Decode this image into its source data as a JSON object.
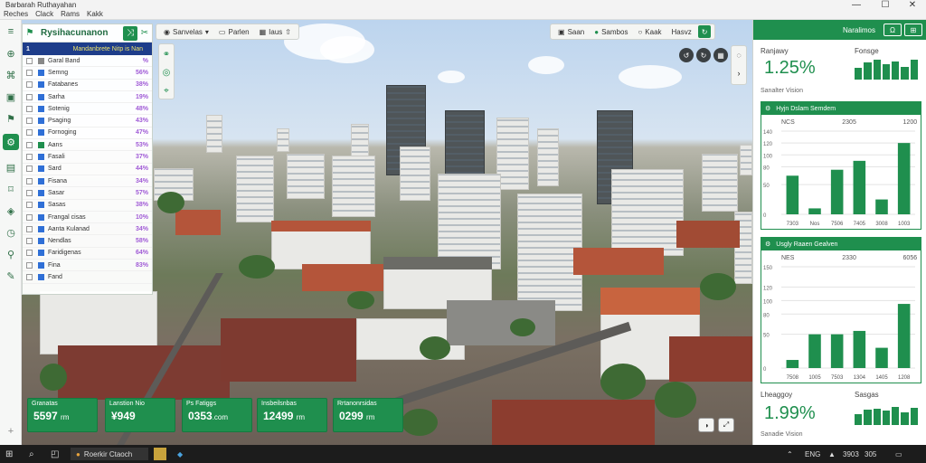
{
  "window": {
    "app_title": "Barbarah Ruthayahan",
    "menu": [
      "Reches",
      "Clack",
      "Rams",
      "Kakk"
    ],
    "minimize": "—",
    "maximize": "☐",
    "close": "✕"
  },
  "rail": {
    "items": [
      {
        "name": "menu-icon",
        "glyph": "≡"
      },
      {
        "name": "globe-icon",
        "glyph": "⊕"
      },
      {
        "name": "chart-icon",
        "glyph": "⌘"
      },
      {
        "name": "building-icon",
        "glyph": "▣"
      },
      {
        "name": "flag-icon",
        "glyph": "⚑"
      },
      {
        "name": "gear-icon",
        "glyph": "⚙"
      },
      {
        "name": "list-icon",
        "glyph": "▤"
      },
      {
        "name": "bookmark-icon",
        "glyph": "⌑"
      },
      {
        "name": "layers-icon",
        "glyph": "◈"
      },
      {
        "name": "clock-icon",
        "glyph": "◷"
      },
      {
        "name": "pin-icon",
        "glyph": "⚲"
      },
      {
        "name": "edit-icon",
        "glyph": "✎"
      }
    ],
    "bottom": "+"
  },
  "layers_panel": {
    "title": "Rysihacunanon",
    "selected": {
      "num": "1",
      "text": "Mandanbrete Nitp is Nan"
    },
    "rows": [
      {
        "name": "Garal Band",
        "pct": "%",
        "color": "#888888"
      },
      {
        "name": "Semng",
        "pct": "56%",
        "color": "#2f6fd6"
      },
      {
        "name": "Fatabanes",
        "pct": "38%",
        "color": "#2f6fd6"
      },
      {
        "name": "Sarha",
        "pct": "19%",
        "color": "#2f6fd6"
      },
      {
        "name": "Sotenig",
        "pct": "48%",
        "color": "#2f6fd6"
      },
      {
        "name": "Psaging",
        "pct": "43%",
        "color": "#2f6fd6"
      },
      {
        "name": "Fornoging",
        "pct": "47%",
        "color": "#2f6fd6"
      },
      {
        "name": "Aans",
        "pct": "53%",
        "color": "#1f8f4e"
      },
      {
        "name": "Fasali",
        "pct": "37%",
        "color": "#2f6fd6"
      },
      {
        "name": "Sard",
        "pct": "44%",
        "color": "#2f6fd6"
      },
      {
        "name": "Fisana",
        "pct": "34%",
        "color": "#2f6fd6"
      },
      {
        "name": "Sasar",
        "pct": "57%",
        "color": "#2f6fd6"
      },
      {
        "name": "Sasas",
        "pct": "38%",
        "color": "#2f6fd6"
      },
      {
        "name": "Frangal cisas",
        "pct": "10%",
        "color": "#2f6fd6"
      },
      {
        "name": "Aanta Kulanad",
        "pct": "34%",
        "color": "#2f6fd6"
      },
      {
        "name": "Nendlas",
        "pct": "58%",
        "color": "#2f6fd6"
      },
      {
        "name": "Faridigenas",
        "pct": "64%",
        "color": "#2f6fd6"
      },
      {
        "name": "Fina",
        "pct": "83%",
        "color": "#2f6fd6"
      },
      {
        "name": "Fand",
        "pct": "",
        "color": "#2f6fd6"
      }
    ]
  },
  "map_toolbar": {
    "left": {
      "btn1": "Sanvelas",
      "btn2": "Parlen",
      "btn3": "Iaus"
    },
    "right": {
      "btn1": "Saan",
      "btn2": "Sambos",
      "btn3": "Kaak",
      "btn4": "Hasvz"
    }
  },
  "stats": [
    {
      "label": "Granatas",
      "value": "5597",
      "unit": "rm"
    },
    {
      "label": "Lanstion Nio",
      "value": "¥949",
      "unit": ""
    },
    {
      "label": "Ps Fatiggs",
      "value": "0353",
      "unit": ".com"
    },
    {
      "label": "Insbeilsnbas",
      "value": "12499",
      "unit": "rm"
    },
    {
      "label": "Rrtanonrsidas",
      "value": "0299",
      "unit": "rm"
    }
  ],
  "right_panel": {
    "header": "Naralimos",
    "btn_left": "Ω",
    "btn_right": "⊞",
    "kpi1": {
      "label": "Ranjawy",
      "value": "1.25%",
      "sub": "Sanalter Vision",
      "mini_label": "Fonsge",
      "mini_bars": [
        0.55,
        0.8,
        0.9,
        0.7,
        0.85,
        0.6,
        0.9
      ]
    },
    "chart1_title": "Hyjn Dslam Semdem",
    "chart2_title": "Usgly Raaen Gealven",
    "kpi2": {
      "label": "Lheaggoy",
      "value": "1.99%",
      "sub": "Sanadie Vision",
      "mini_label": "Sasgas",
      "mini_bars": [
        0.5,
        0.7,
        0.75,
        0.65,
        0.85,
        0.6,
        0.8
      ]
    }
  },
  "chart_data": [
    {
      "type": "bar",
      "title": "Hyjn Dslam Semdem",
      "categories": [
        "7303",
        "Nos",
        "7506",
        "7405",
        "3008",
        "1003"
      ],
      "values": [
        65,
        10,
        75,
        90,
        25,
        120
      ],
      "top_labels": [
        "NCS",
        "2305",
        "1200"
      ],
      "ylim": [
        0,
        140
      ],
      "yticks": [
        0,
        50,
        80,
        100,
        120,
        140
      ],
      "color": "#1f8f4e"
    },
    {
      "type": "bar",
      "title": "Usgly Raaen Gealven",
      "categories": [
        "7508",
        "1005",
        "7503",
        "1304",
        "1405",
        "1208"
      ],
      "values": [
        12,
        50,
        50,
        55,
        30,
        95
      ],
      "top_labels": [
        "NES",
        "2330",
        "6056"
      ],
      "ylim": [
        0,
        150
      ],
      "yticks": [
        0,
        50,
        80,
        100,
        120,
        150
      ],
      "color": "#1f8f4e"
    }
  ],
  "taskbar": {
    "search": "⌕",
    "app": "Roerkir Ctaoch",
    "lang": "ENG",
    "time": "3903",
    "date": "305"
  }
}
